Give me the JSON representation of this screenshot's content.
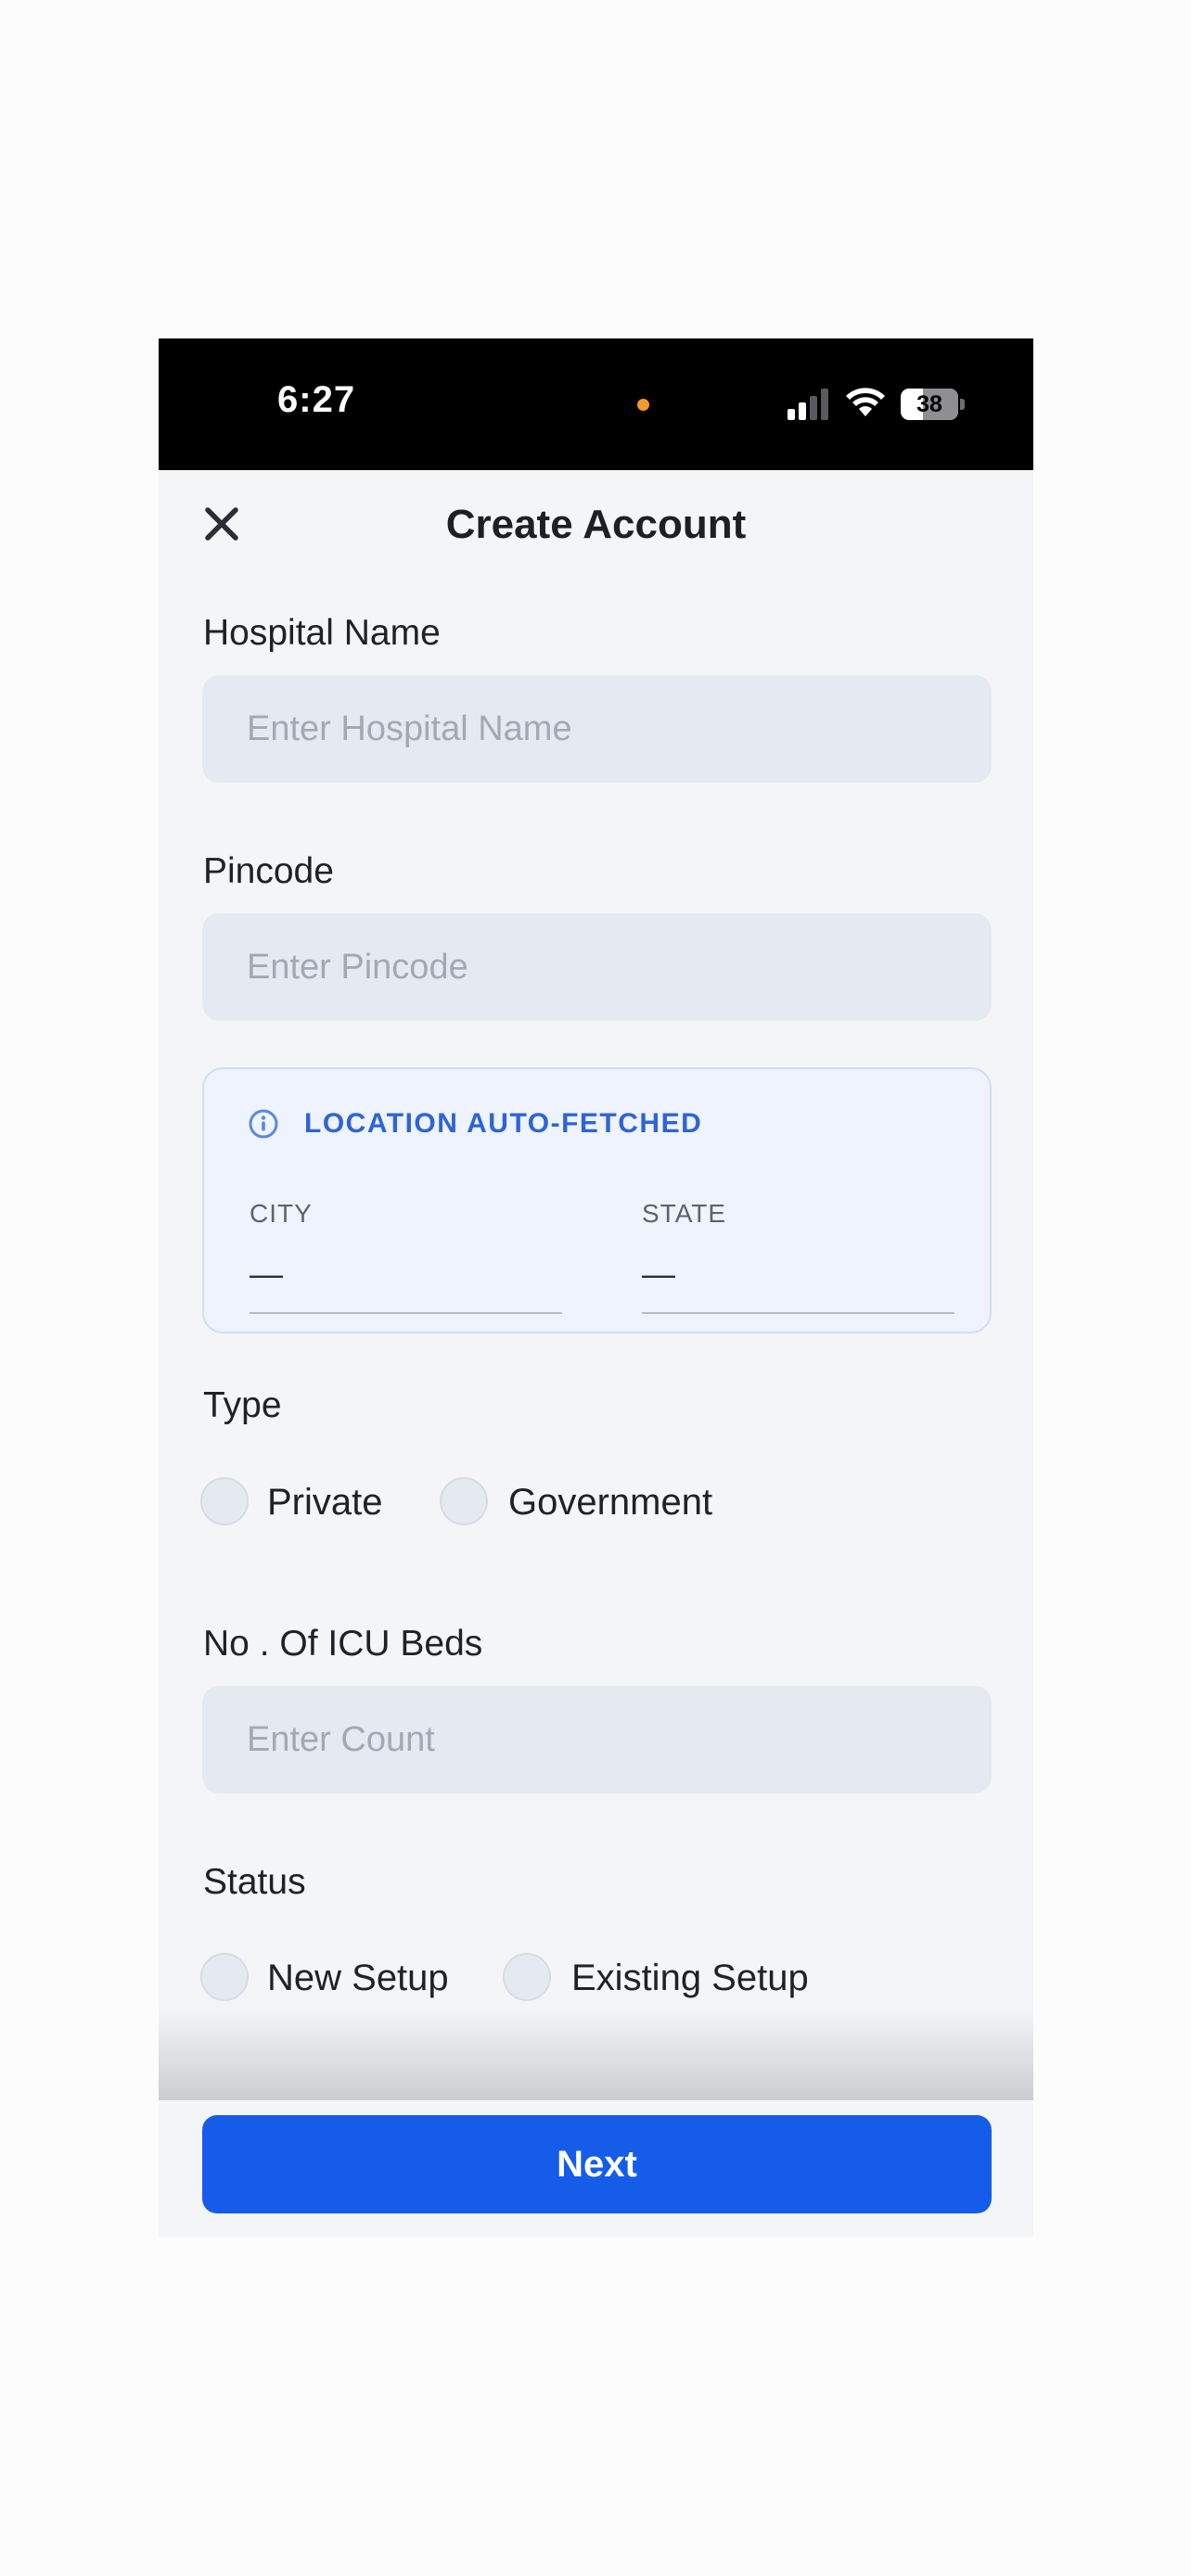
{
  "status_bar": {
    "time": "6:27",
    "battery_level": "38",
    "battery_fraction": 0.38,
    "icons": [
      "orange-dot-indicator",
      "signal-icon",
      "wifi-icon",
      "battery-icon"
    ]
  },
  "header": {
    "title": "Create Account",
    "close_icon": "close-icon"
  },
  "form": {
    "hospital_name": {
      "label": "Hospital Name",
      "placeholder": "Enter Hospital Name",
      "value": ""
    },
    "pincode": {
      "label": "Pincode",
      "placeholder": "Enter Pincode",
      "value": ""
    },
    "location": {
      "title": "LOCATION AUTO-FETCHED",
      "icon": "info-icon",
      "city_label": "CITY",
      "city_value": "—",
      "state_label": "STATE",
      "state_value": "—"
    },
    "type": {
      "label": "Type",
      "options": [
        "Private",
        "Government"
      ],
      "selected": ""
    },
    "icu_beds": {
      "label": "No . Of ICU Beds",
      "placeholder": "Enter Count",
      "value": ""
    },
    "status": {
      "label": "Status",
      "options": [
        "New Setup",
        "Existing Setup"
      ],
      "selected": ""
    }
  },
  "footer": {
    "next_label": "Next"
  },
  "colors": {
    "accent": "#155de9",
    "location_title": "#2e64d8",
    "input_bg": "#e5e9f1",
    "page_bg": "#f4f5f7",
    "status_dot": "#f79a2c"
  }
}
